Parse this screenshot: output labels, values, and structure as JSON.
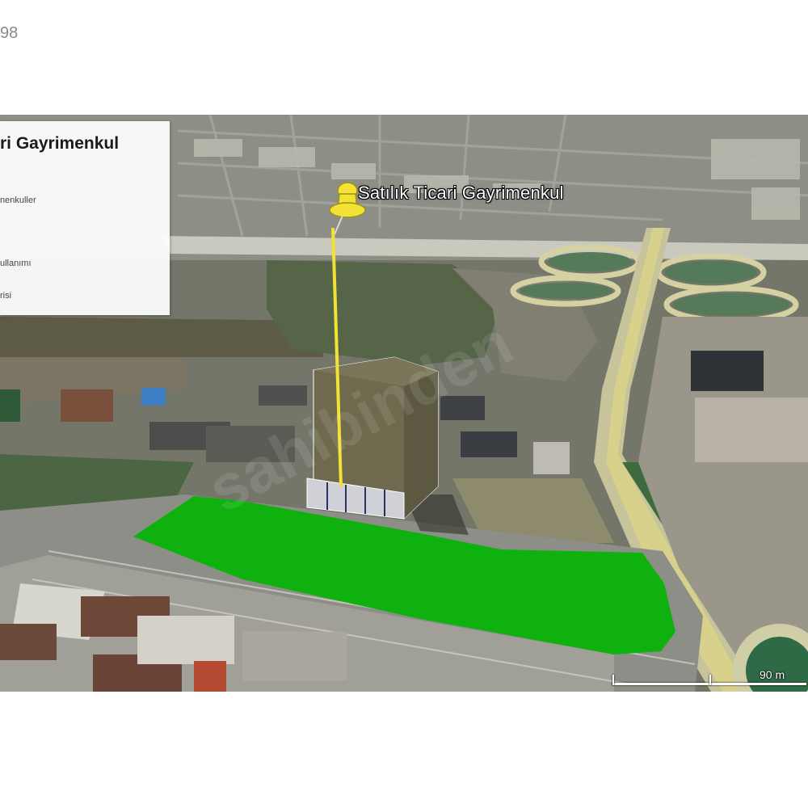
{
  "page": {
    "corner_text": "98"
  },
  "legend": {
    "title": "ri Gayrimenkul",
    "items": [
      "nenkuller",
      "",
      "ullanımı",
      "risi"
    ]
  },
  "placemark": {
    "label": "Satılık Ticari Gayrimenkul",
    "icon": "yellow-pushpin-icon"
  },
  "scale": {
    "label": "90 m"
  },
  "highlight": {
    "parcel_color": "#0fb10f"
  },
  "colors": {
    "pin": "#f2e233",
    "building": "#6f6a4d"
  }
}
